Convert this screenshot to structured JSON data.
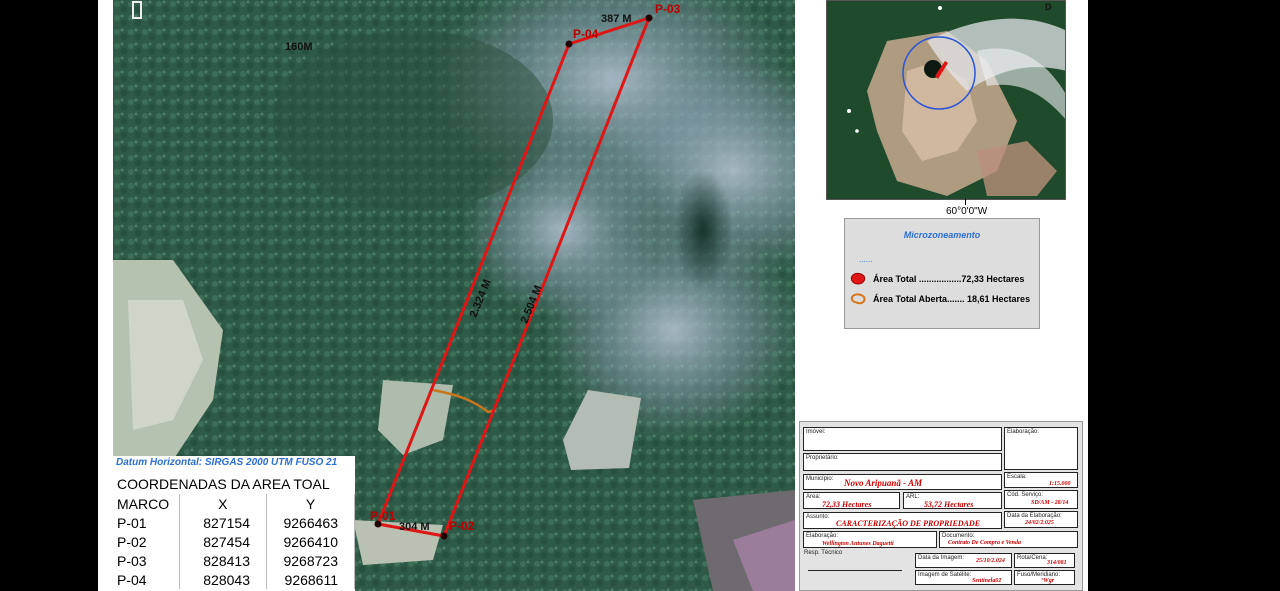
{
  "map": {
    "scale_text": "160M",
    "points": {
      "p01": "P-01",
      "p02": "P-02",
      "p03": "P-03",
      "p04": "P-04"
    },
    "distances": {
      "d_top": "387 M",
      "d_left": "2.324 M",
      "d_right": "2.504 M",
      "d_bottom": "304 M"
    },
    "colors": {
      "boundary": "#e01515",
      "open_area": "#c8761a"
    }
  },
  "coordinates": {
    "datum": "Datum Horizontal: SIRGAS 2000 UTM FUSO 21",
    "title": "COORDENADAS DA AREA TOAL",
    "headers": {
      "marco": "MARCO",
      "x": "X",
      "y": "Y"
    },
    "rows": [
      {
        "marco": "P-01",
        "x": "827154",
        "y": "9266463"
      },
      {
        "marco": "P-02",
        "x": "827454",
        "y": "9266410"
      },
      {
        "marco": "P-03",
        "x": "828413",
        "y": "9268723"
      },
      {
        "marco": "P-04",
        "x": "828043",
        "y": "9268611"
      }
    ]
  },
  "inset": {
    "longitude": "60°0'0\"W",
    "corner": "D"
  },
  "legend": {
    "title": "Microzoneamento",
    "dots": "......",
    "total_label": "Área Total .................72,33 Hectares",
    "open_label": "Área Total Aberta....... 18,61 Hectares"
  },
  "title_block": {
    "imovel_cap": "Imóvel:",
    "proprietario_cap": "Proprietário:",
    "elaboracao_cap": "Elaboração:",
    "municipio_cap": "Município:",
    "municipio": "Novo Aripuanã - AM",
    "escala_cap": "Escala:",
    "escala": "1:15.000",
    "area_cap": "Área:",
    "area": "72,33 Hectares",
    "arl_cap": "ARL:",
    "arl": "53,72 Hectares",
    "cod_cap": "Cód. Serviço:",
    "cod": "SD/AM - 28/14",
    "assunto_cap": "Assunto:",
    "assunto": "CARACTERIZAÇÃO DE PROPRIEDADE",
    "data_elab_cap": "Data da Elaboração:",
    "data_elab": "24/02/2.025",
    "elaboracao2_cap": "Elaboração:",
    "elaborador": "Wellington Antunes Daguetti",
    "documento_cap": "Documento:",
    "documento": "Contrato De Compra e Venda",
    "resp_cap": "Resp. Técnico",
    "data_img_cap": "Data da Imagem:",
    "data_img": "25/10/2.024",
    "rota_cap": "Rota/Cena:",
    "rota": "314/081",
    "sat_cap": "Imagem de Satélite:",
    "sat": "Sentinela02",
    "fuso_cap": "Fuso/Meridiano:",
    "fuso": "°Wgr"
  }
}
